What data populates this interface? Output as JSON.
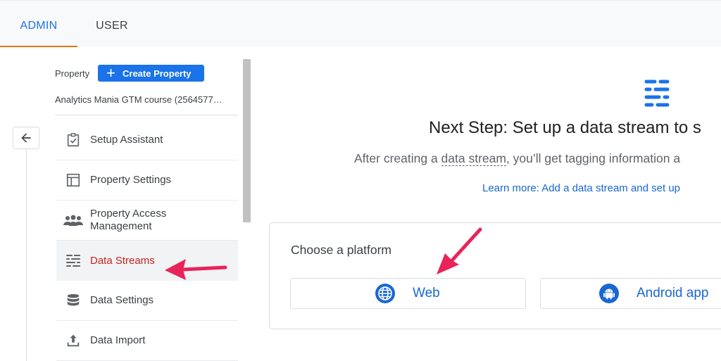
{
  "tabs": {
    "admin": "ADMIN",
    "user": "USER"
  },
  "property": {
    "label": "Property",
    "create_button": "Create Property",
    "name": "Analytics Mania GTM course (2564577…"
  },
  "nav": {
    "items": [
      {
        "label": "Setup Assistant",
        "icon": "checklist-icon"
      },
      {
        "label": "Property Settings",
        "icon": "layout-icon"
      },
      {
        "label": "Property Access",
        "label2": "Management",
        "icon": "people-icon"
      },
      {
        "label": "Data Streams",
        "icon": "data-streams-icon",
        "active": true
      },
      {
        "label": "Data Settings",
        "icon": "database-icon"
      },
      {
        "label": "Data Import",
        "icon": "upload-icon"
      }
    ]
  },
  "main": {
    "headline": "Next Step: Set up a data stream to s",
    "subline_before": "After creating a ",
    "subline_term": "data stream",
    "subline_after": ", you’ll get tagging information a",
    "learn_more": "Learn more: Add a data stream and set up",
    "platform": {
      "title": "Choose a platform",
      "web": "Web",
      "android": "Android app"
    }
  },
  "colors": {
    "accent_blue": "#1a73e8",
    "active_red": "#c5221f",
    "annotation_arrow": "#e8245a",
    "tab_underline": "#e37400"
  }
}
